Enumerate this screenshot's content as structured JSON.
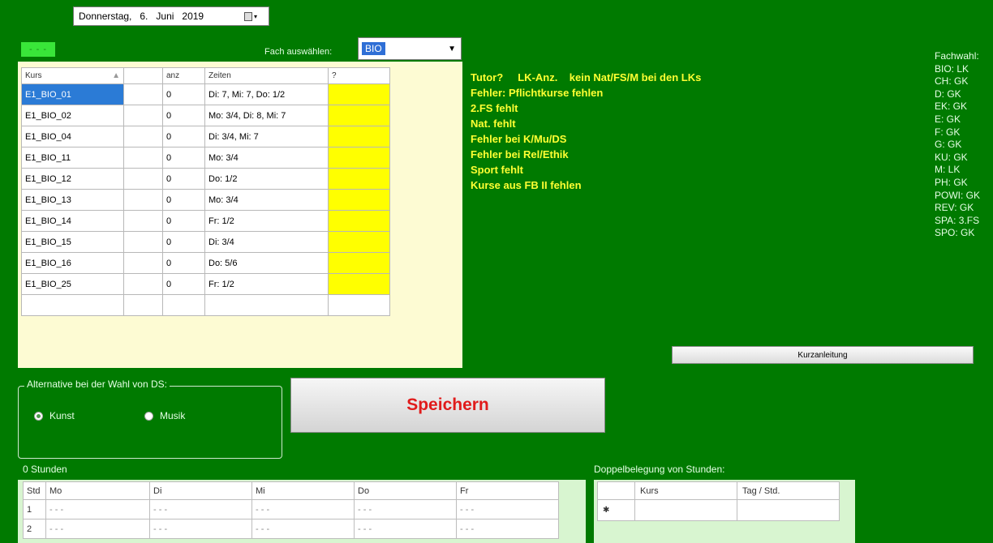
{
  "date": {
    "weekday": "Donnerstag,",
    "day": "6.",
    "month": "Juni",
    "year": "2019"
  },
  "indicator": "- - -",
  "fach": {
    "label": "Fach auswählen:",
    "value": "BIO"
  },
  "kurse_table": {
    "headers": [
      "Kurs",
      "anz",
      "Zeiten",
      "?"
    ],
    "rows": [
      {
        "kurs": "E1_BIO_01",
        "anz": "0",
        "zeiten": "Di: 7, Mi: 7, Do: 1/2"
      },
      {
        "kurs": "E1_BIO_02",
        "anz": "0",
        "zeiten": "Mo: 3/4, Di: 8, Mi: 7"
      },
      {
        "kurs": "E1_BIO_04",
        "anz": "0",
        "zeiten": "Di: 3/4, Mi: 7"
      },
      {
        "kurs": "E1_BIO_11",
        "anz": "0",
        "zeiten": "Mo: 3/4"
      },
      {
        "kurs": "E1_BIO_12",
        "anz": "0",
        "zeiten": "Do: 1/2"
      },
      {
        "kurs": "E1_BIO_13",
        "anz": "0",
        "zeiten": "Mo: 3/4"
      },
      {
        "kurs": "E1_BIO_14",
        "anz": "0",
        "zeiten": "Fr: 1/2"
      },
      {
        "kurs": "E1_BIO_15",
        "anz": "0",
        "zeiten": "Di: 3/4"
      },
      {
        "kurs": "E1_BIO_16",
        "anz": "0",
        "zeiten": "Do: 5/6"
      },
      {
        "kurs": "E1_BIO_25",
        "anz": "0",
        "zeiten": "Fr: 1/2"
      }
    ]
  },
  "status_lines": [
    "Tutor?     LK-Anz.    kein Nat/FS/M bei den LKs",
    "Fehler: Pflichtkurse fehlen",
    "2.FS fehlt",
    "Nat. fehlt",
    "Fehler bei K/Mu/DS",
    "Fehler bei Rel/Ethik",
    "Sport fehlt",
    "Kurse aus FB II fehlen"
  ],
  "fachwahl": {
    "title": "Fachwahl:",
    "items": [
      "BIO: LK",
      "CH: GK",
      "D: GK",
      "EK: GK",
      "E: GK",
      "F: GK",
      "G: GK",
      "KU: GK",
      "M: LK",
      "PH: GK",
      "POWI: GK",
      "REV: GK",
      "SPA: 3.FS",
      "SPO: GK"
    ]
  },
  "kurzanleitung_label": "Kurzanleitung",
  "alternative": {
    "title": "Alternative bei der Wahl von DS:",
    "options": [
      "Kunst",
      "Musik"
    ],
    "selected": "Kunst"
  },
  "save_label": "Speichern",
  "stunden_label": "0 Stunden",
  "plan": {
    "headers": [
      "Std",
      "Mo",
      "Di",
      "Mi",
      "Do",
      "Fr"
    ],
    "rows": [
      [
        "1",
        "- - -",
        "- - -",
        "- - -",
        "- - -",
        "- - -"
      ],
      [
        "2",
        "- - -",
        "- - -",
        "- - -",
        "- - -",
        "- - -"
      ]
    ]
  },
  "doppel": {
    "title": "Doppelbelegung von Stunden:",
    "headers": [
      "Kurs",
      "Tag / Std."
    ],
    "row_marker": "✱"
  }
}
